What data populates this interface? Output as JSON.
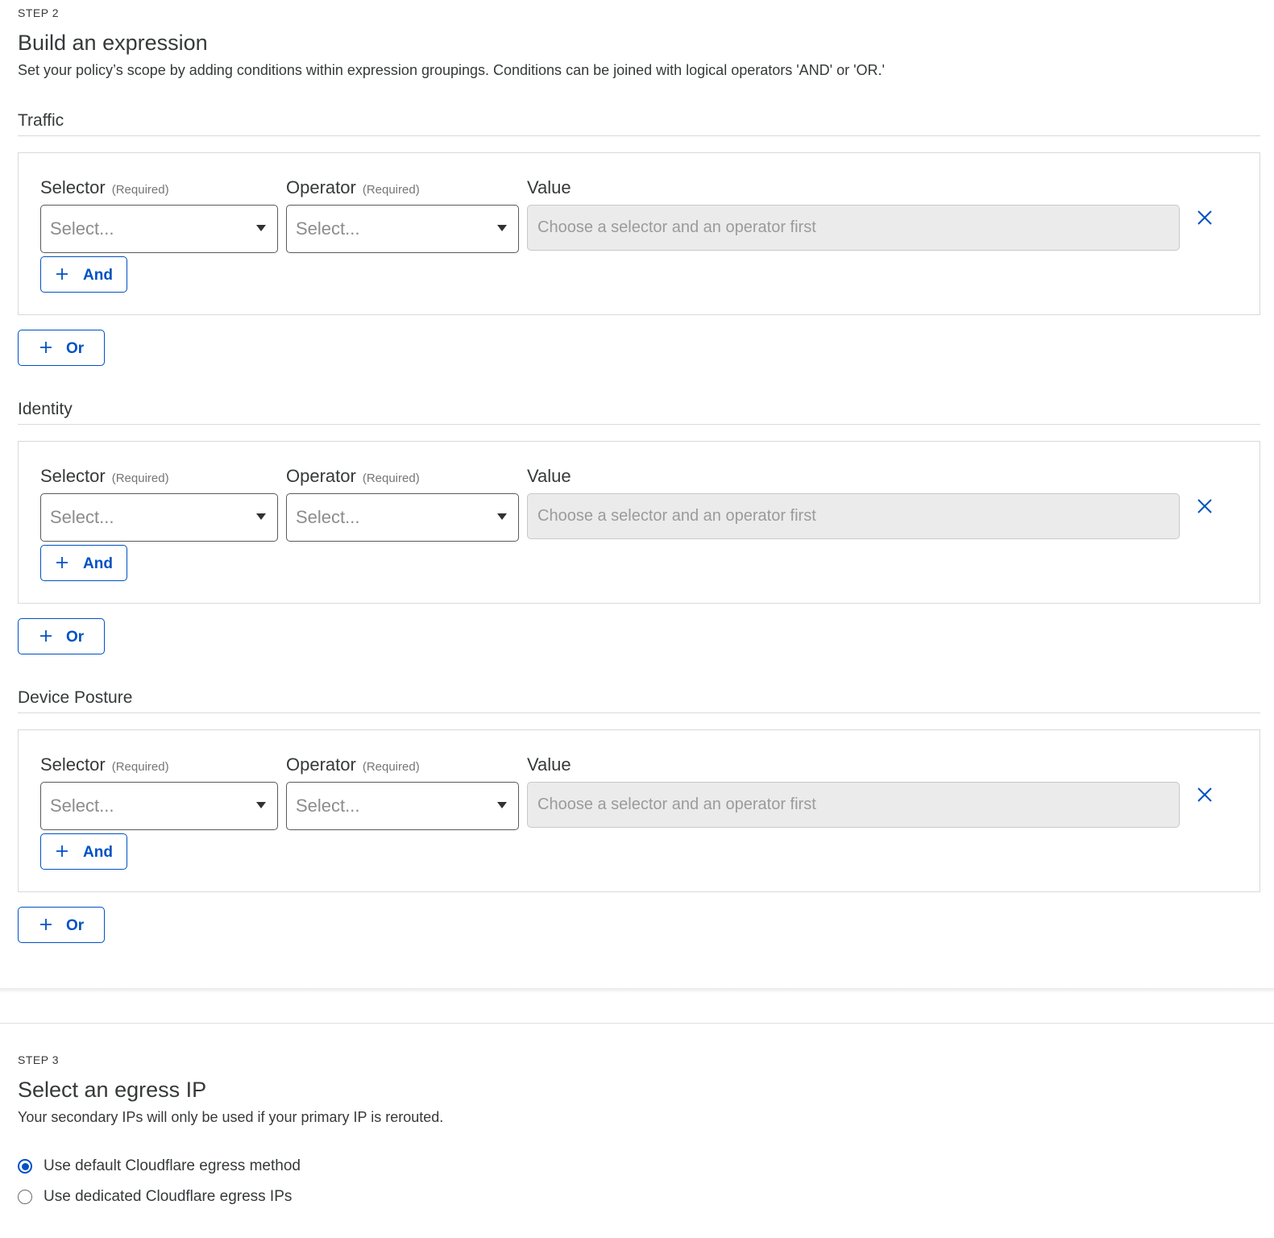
{
  "step2": {
    "label": "STEP 2",
    "title": "Build an expression",
    "description": "Set your policy’s scope by adding conditions within expression groupings. Conditions can be joined with logical operators 'AND' or 'OR.'"
  },
  "fields": {
    "selector_label": "Selector",
    "operator_label": "Operator",
    "value_label": "Value",
    "required_hint": "(Required)",
    "select_placeholder": "Select...",
    "value_placeholder": "Choose a selector and an operator first",
    "and_label": "And",
    "or_label": "Or"
  },
  "sections": [
    {
      "title": "Traffic"
    },
    {
      "title": "Identity"
    },
    {
      "title": "Device Posture"
    }
  ],
  "step3": {
    "label": "STEP 3",
    "title": "Select an egress IP",
    "description": "Your secondary IPs will only be used if your primary IP is rerouted.",
    "options": [
      {
        "label": "Use default Cloudflare egress method",
        "selected": true
      },
      {
        "label": "Use dedicated Cloudflare egress IPs",
        "selected": false
      }
    ]
  },
  "colors": {
    "accent": "#0051c3",
    "disabled_field": "#ebebeb",
    "border": "#d9d9d9"
  },
  "icons": {
    "remove": "close-icon",
    "add": "plus-icon",
    "dropdown": "caret-down-icon"
  }
}
